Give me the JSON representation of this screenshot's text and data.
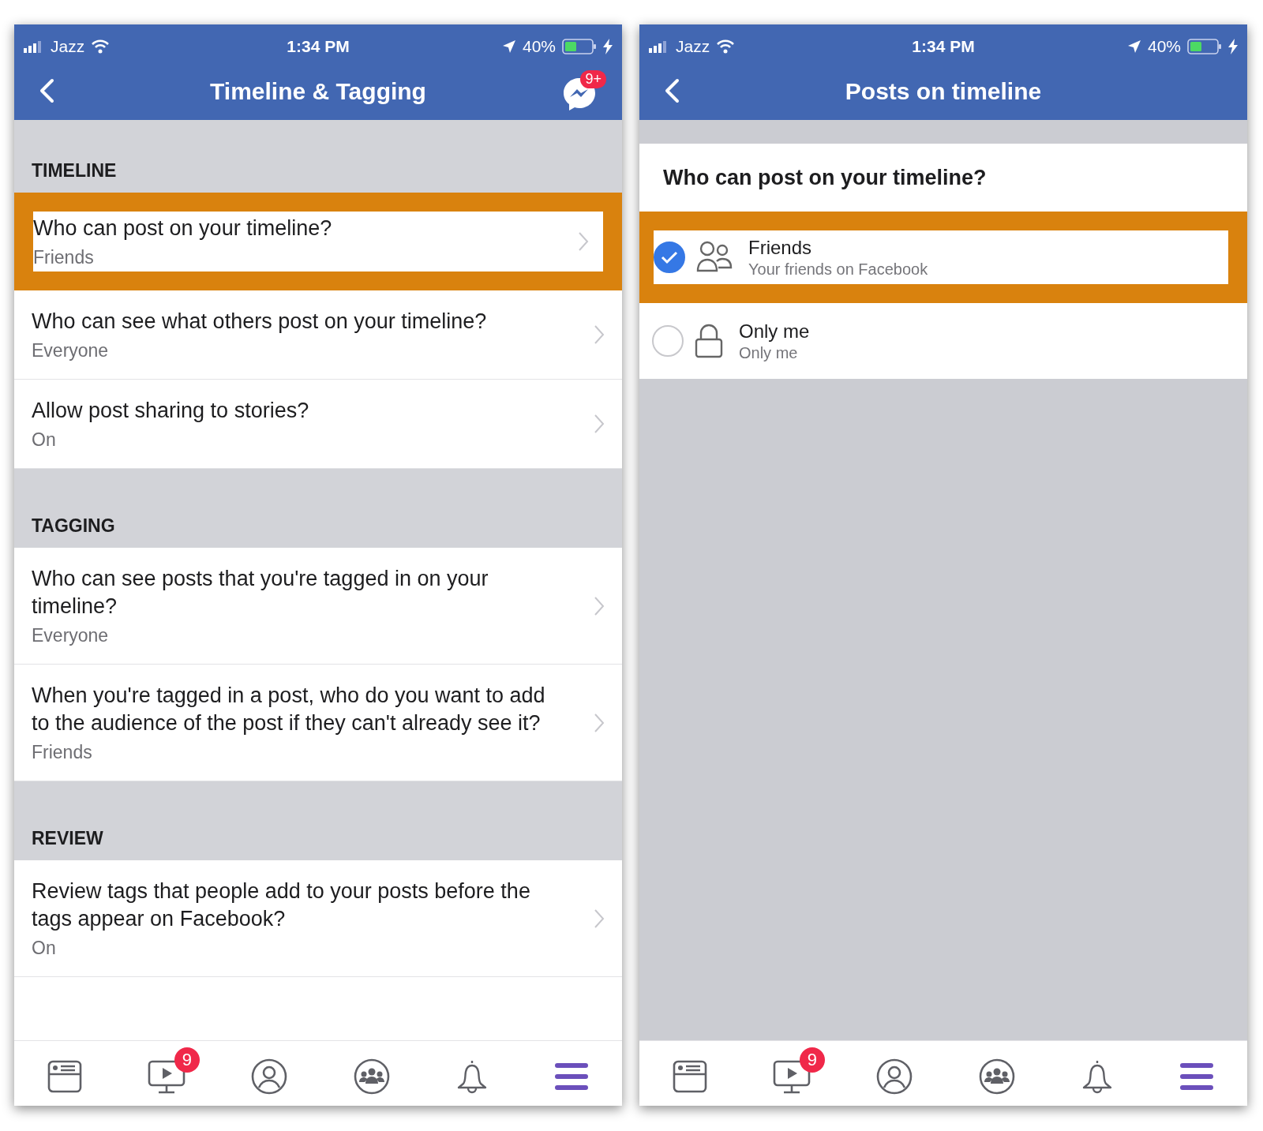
{
  "left_screen": {
    "status_bar": {
      "carrier": "Jazz",
      "time": "1:34 PM",
      "battery": "40%"
    },
    "nav": {
      "title": "Timeline & Tagging",
      "messenger_badge": "9+"
    },
    "sections": [
      {
        "header": "TIMELINE",
        "rows": [
          {
            "title": "Who can post on your timeline?",
            "value": "Friends",
            "highlighted": true
          },
          {
            "title": "Who can see what others post on your timeline?",
            "value": "Everyone",
            "highlighted": false
          },
          {
            "title": "Allow post sharing to stories?",
            "value": "On",
            "highlighted": false
          }
        ]
      },
      {
        "header": "TAGGING",
        "rows": [
          {
            "title": "Who can see posts that you're tagged in on your timeline?",
            "value": "Everyone",
            "highlighted": false
          },
          {
            "title": "When you're tagged in a post, who do you want to add to the audience of the post if they can't already see it?",
            "value": "Friends",
            "highlighted": false
          }
        ]
      },
      {
        "header": "REVIEW",
        "rows": [
          {
            "title": "Review tags that people add to your posts before the tags appear on Facebook?",
            "value": "On",
            "highlighted": false
          }
        ]
      }
    ],
    "tab_bar": [
      {
        "kind": "news",
        "selected": false
      },
      {
        "kind": "video",
        "badge": "9",
        "selected": false
      },
      {
        "kind": "profile",
        "selected": false
      },
      {
        "kind": "groups",
        "selected": false
      },
      {
        "kind": "bell",
        "selected": false
      },
      {
        "kind": "menu",
        "selected": true
      }
    ]
  },
  "right_screen": {
    "status_bar": {
      "carrier": "Jazz",
      "time": "1:34 PM",
      "battery": "40%"
    },
    "nav": {
      "title": "Posts on timeline"
    },
    "question": "Who can post on your timeline?",
    "options": [
      {
        "kind": "people",
        "title": "Friends",
        "subtitle": "Your friends on Facebook",
        "selected": true,
        "highlighted": true
      },
      {
        "kind": "lock",
        "title": "Only me",
        "subtitle": "Only me",
        "selected": false,
        "highlighted": false
      }
    ],
    "tab_bar": [
      {
        "kind": "news",
        "selected": false
      },
      {
        "kind": "video",
        "badge": "9",
        "selected": false
      },
      {
        "kind": "profile",
        "selected": false
      },
      {
        "kind": "groups",
        "selected": false
      },
      {
        "kind": "bell",
        "selected": false
      },
      {
        "kind": "menu",
        "selected": true
      }
    ]
  }
}
